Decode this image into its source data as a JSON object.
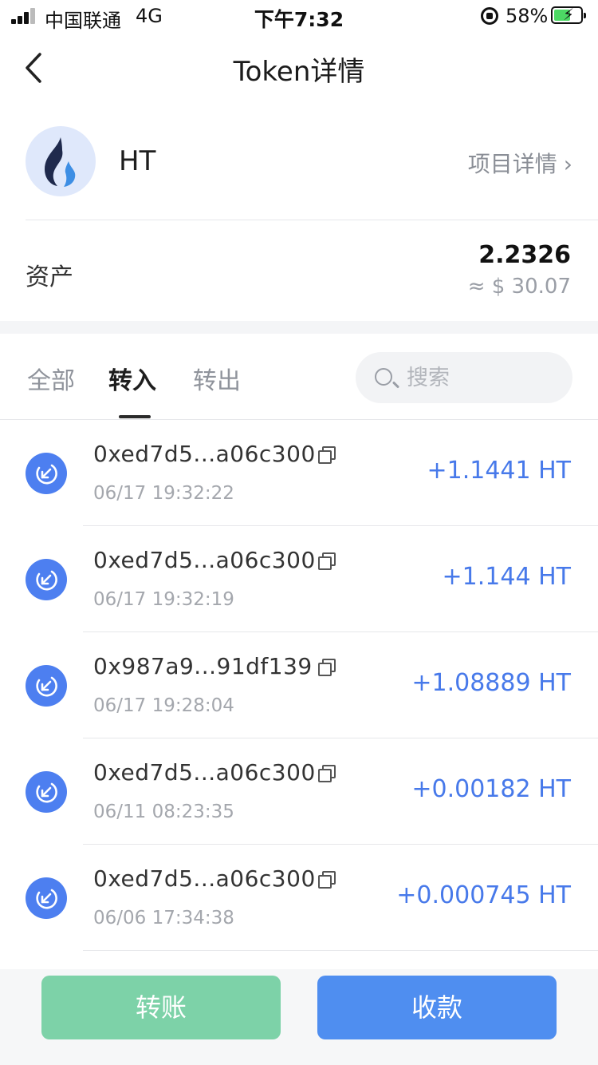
{
  "status_bar": {
    "carrier": "中国联通",
    "network": "4G",
    "time": "下午7:32",
    "battery": "58%"
  },
  "nav": {
    "title": "Token详情"
  },
  "token": {
    "symbol": "HT",
    "project_link": "项目详情"
  },
  "asset": {
    "label": "资产",
    "amount": "2.2326",
    "fiat": "≈ $ 30.07"
  },
  "tabs": [
    {
      "label": "全部",
      "active": false
    },
    {
      "label": "转入",
      "active": true
    },
    {
      "label": "转出",
      "active": false
    }
  ],
  "search": {
    "placeholder": "搜索"
  },
  "transactions": [
    {
      "address": "0xed7d5...a06c300",
      "time": "06/17 19:32:22",
      "amount": "+1.1441 HT"
    },
    {
      "address": "0xed7d5...a06c300",
      "time": "06/17 19:32:19",
      "amount": "+1.144 HT"
    },
    {
      "address": "0x987a9...91df139",
      "time": "06/17 19:28:04",
      "amount": "+1.08889 HT"
    },
    {
      "address": "0xed7d5...a06c300",
      "time": "06/11 08:23:35",
      "amount": "+0.00182 HT"
    },
    {
      "address": "0xed7d5...a06c300",
      "time": "06/06 17:34:38",
      "amount": "+0.000745 HT"
    }
  ],
  "actions": {
    "transfer": "转账",
    "receive": "收款"
  },
  "colors": {
    "accent_blue": "#4779ea",
    "transfer_green": "#7dd2a8",
    "receive_blue": "#4f8ef0"
  }
}
